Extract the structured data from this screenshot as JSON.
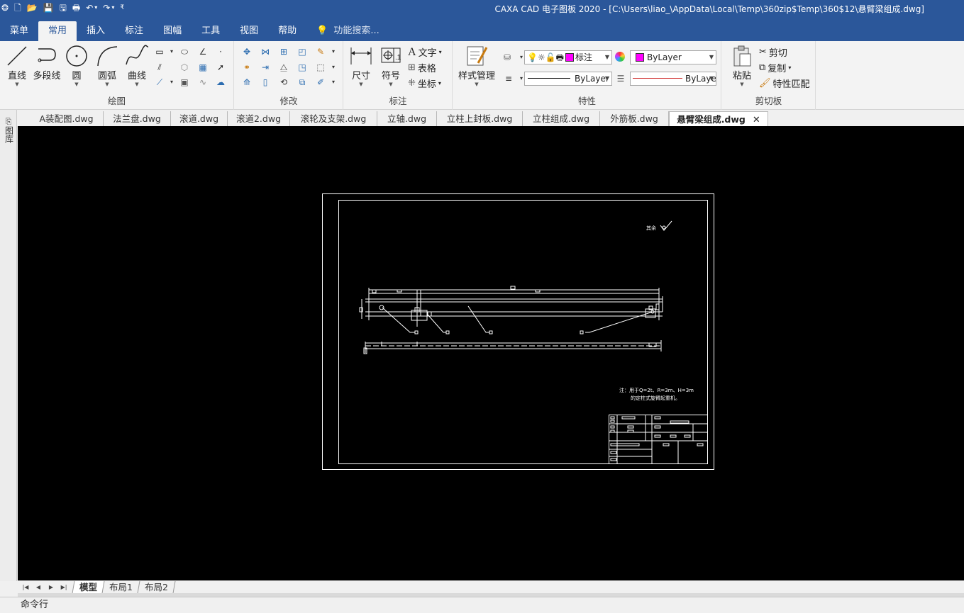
{
  "titlebar": {
    "title": "CAXA CAD 电子图板 2020 - [C:\\Users\\liao_\\AppData\\Local\\Temp\\360zip$Temp\\360$12\\悬臂梁组成.dwg]",
    "qat_icons": [
      "app-logo-icon",
      "new-file-icon",
      "open-folder-icon",
      "save-icon",
      "save-as-icon",
      "print-icon",
      "undo-icon",
      "redo-icon",
      "customize-icon"
    ]
  },
  "menubar": {
    "tabs": [
      "菜单",
      "常用",
      "插入",
      "标注",
      "图幅",
      "工具",
      "视图",
      "帮助"
    ],
    "active_tab": "常用",
    "search_placeholder": "功能搜索..."
  },
  "ribbon": {
    "draw": {
      "label": "绘图",
      "line": "直线",
      "polyline": "多段线",
      "circle": "圆",
      "arc": "圆弧",
      "curve": "曲线"
    },
    "modify": {
      "label": "修改"
    },
    "annotate": {
      "label": "标注",
      "dimension": "尺寸",
      "symbol": "符号",
      "text": "文字",
      "table": "表格",
      "coordinate": "坐标"
    },
    "properties": {
      "label": "特性",
      "style_manager": "样式管理",
      "layer_name": "标注",
      "color_value": "ByLayer",
      "linetype_value": "ByLayer",
      "lineweight_value": "ByLaye"
    },
    "clipboard": {
      "label": "剪切板",
      "paste": "粘贴",
      "cut": "剪切",
      "copy": "复制",
      "match_prop": "特性匹配"
    }
  },
  "colors": {
    "accent": "#2b579a",
    "layer_color": "#ff00ff",
    "lineweight_color": "#d03030",
    "canvas": "#000000"
  },
  "side_panel": {
    "label": "图库"
  },
  "doc_tabs": [
    "A装配图.dwg",
    "法兰盘.dwg",
    "滚道.dwg",
    "滚道2.dwg",
    "滚轮及支架.dwg",
    "立轴.dwg",
    "立柱上封板.dwg",
    "立柱组成.dwg",
    "外筋板.dwg",
    "悬臂梁组成.dwg"
  ],
  "active_doc": "悬臂梁组成.dwg",
  "drawing": {
    "roughness_note": "其余",
    "tech_note_line1": "注：用于Q=2t、R=3m、H=3m",
    "tech_note_line2": "的定柱式旋臂起重机。"
  },
  "layout_tabs": [
    "模型",
    "布局1",
    "布局2"
  ],
  "active_layout": "模型",
  "command_line": {
    "label": "命令行"
  }
}
